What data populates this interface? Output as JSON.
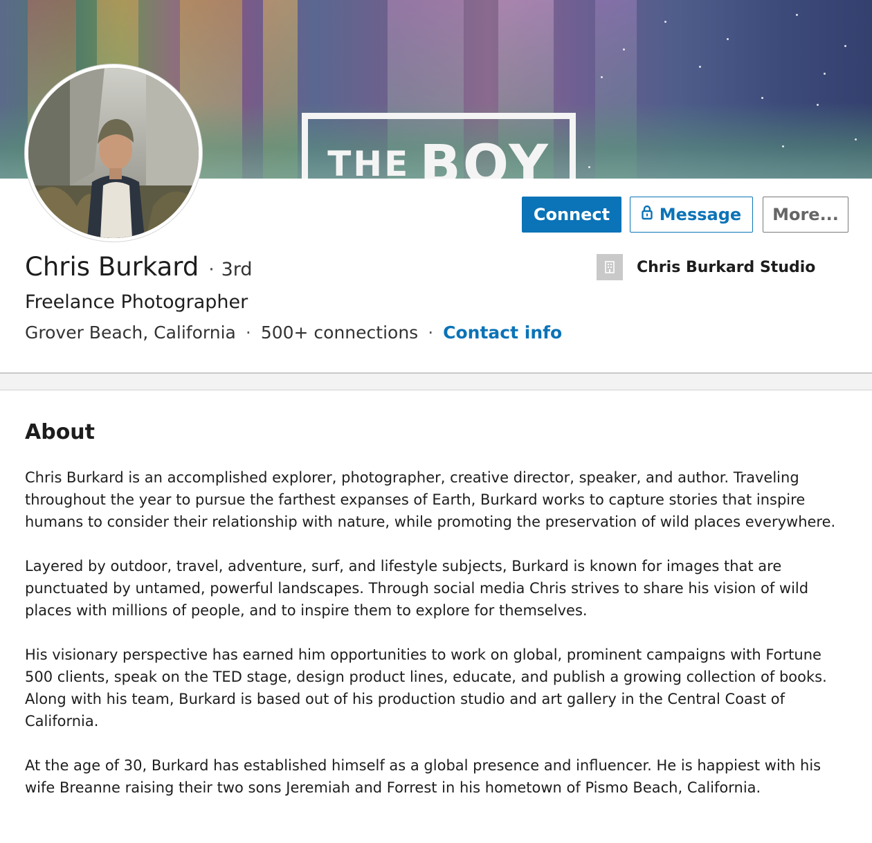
{
  "cover": {
    "sign_word_1": "THE",
    "sign_word_2": "BOY"
  },
  "profile": {
    "name": "Chris Burkard",
    "degree_separator": "·",
    "degree": "3rd",
    "headline": "Freelance Photographer",
    "location": "Grover Beach, California",
    "meta_separator": "·",
    "connections": "500+ connections",
    "contact_info_label": "Contact info",
    "company_name": "Chris Burkard Studio"
  },
  "actions": {
    "connect_label": "Connect",
    "message_label": "Message",
    "more_label": "More..."
  },
  "about": {
    "title": "About",
    "paragraphs": [
      "Chris Burkard is an accomplished explorer, photographer, creative director, speaker, and author. Traveling throughout the year to pursue the farthest expanses of Earth, Burkard works to capture stories that inspire humans to consider their relationship with nature, while promoting the preservation of wild places everywhere.",
      "Layered by outdoor, travel, adventure, surf, and lifestyle subjects, Burkard is known for images that are punctuated by untamed, powerful landscapes. Through social media Chris strives to share his vision of wild places with millions of people, and to inspire them to explore for themselves.",
      "His visionary perspective has earned him opportunities to work on global, prominent campaigns with Fortune 500 clients, speak on the TED stage, design product lines, educate, and publish a growing collection of books. Along with his team, Burkard is based out of his production studio and art gallery in the Central Coast of California.",
      "At the age of 30, Burkard has established himself as a global presence and influencer. He is happiest with his wife Breanne raising their two sons Jeremiah and Forrest in his hometown of Pismo Beach, California."
    ]
  },
  "icons": {
    "lock": "lock-icon",
    "company_logo": "building-icon"
  },
  "colors": {
    "brand_blue": "#0b73b7",
    "text_primary": "#1d1d1d",
    "more_button_text": "#666666",
    "company_logo_bg": "#c9c9c9"
  }
}
